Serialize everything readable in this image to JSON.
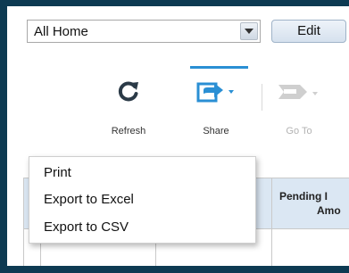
{
  "view_select": {
    "value": "All Home"
  },
  "edit_button": {
    "label": "Edit"
  },
  "toolbar": {
    "refresh_label": "Refresh",
    "share_label": "Share",
    "goto_label": "Go To"
  },
  "context_menu": {
    "items": [
      {
        "label": "Print"
      },
      {
        "label": "Export to Excel"
      },
      {
        "label": "Export to CSV"
      }
    ]
  },
  "grid": {
    "header": {
      "line1": "Pending I",
      "line2": "Amo"
    }
  },
  "colors": {
    "frame": "#0d3a52",
    "accent": "#2a8fd4",
    "icon_dark": "#2b3a47",
    "icon_disabled": "#cfcfcf",
    "header_bg": "#dbe7f3"
  }
}
